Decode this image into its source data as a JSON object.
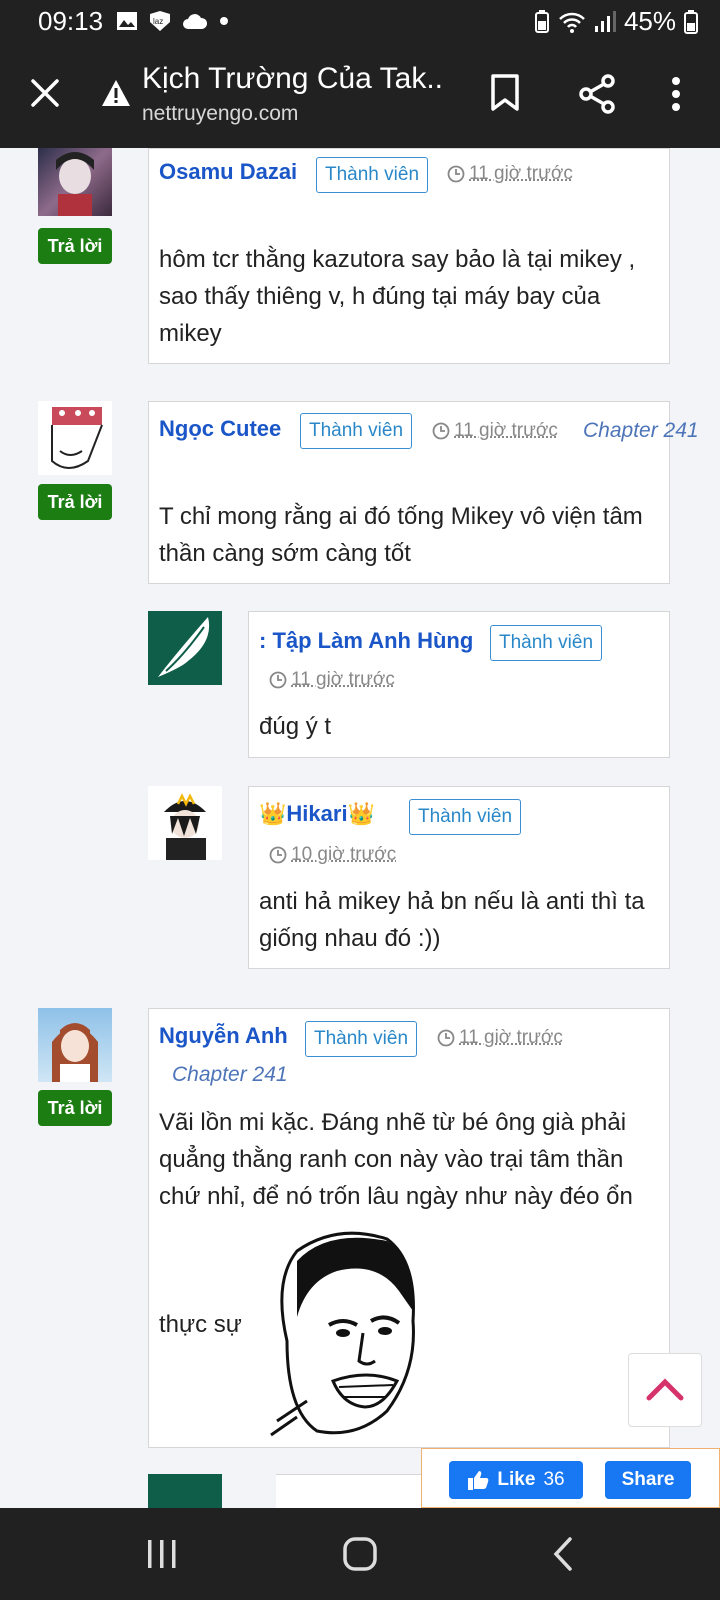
{
  "status": {
    "time": "09:13",
    "battery": "45%"
  },
  "browser": {
    "title": "Kịch Trường Của Tak...",
    "url": "nettruyengo.com"
  },
  "comments": [
    {
      "name": "Osamu Dazai",
      "badge": "Thành viên",
      "time": "11 giờ trước",
      "chapter": "",
      "reply": "Trả lời",
      "text": "hôm tcr thằng kazutora say bảo là tại mikey , sao thấy thiêng v, h đúng tại máy bay của mikey"
    },
    {
      "name": "Ngọc Cutee",
      "badge": "Thành viên",
      "time": "11 giờ trước",
      "chapter": "Chapter 241",
      "reply": "Trả lời",
      "text": "T chỉ mong rằng ai đó tống Mikey vô viện tâm thần càng sớm càng tốt",
      "replies": [
        {
          "name": ": Tập Làm Anh Hùng",
          "badge": "Thành viên",
          "time": "11 giờ trước",
          "text": "đúg ý t"
        },
        {
          "name": "Hikari",
          "crown": "👑",
          "badge": "Thành viên",
          "time": "10 giờ trước",
          "text": "anti hả mikey hả bn nếu là anti thì ta giống nhau đó :))"
        }
      ]
    },
    {
      "name": "Nguyễn Anh",
      "badge": "Thành viên",
      "time": "11 giờ trước",
      "chapter": "Chapter 241",
      "reply": "Trả lời",
      "text": "Vãi lồn mi kặc. Đáng nhẽ từ bé ông già phải quẳng thằng ranh con này vào trại tâm thần chứ nhỉ, để nó trốn lâu ngày như này đéo ổn",
      "text2": "thực sự"
    }
  ],
  "facebook": {
    "like_label": "Like",
    "like_count": "36",
    "share_label": "Share"
  },
  "colors": {
    "bar": "#212121",
    "name": "#1a56c7",
    "reply": "#1b7d12",
    "fb": "#1877f2",
    "badge": "#2a88c9"
  }
}
